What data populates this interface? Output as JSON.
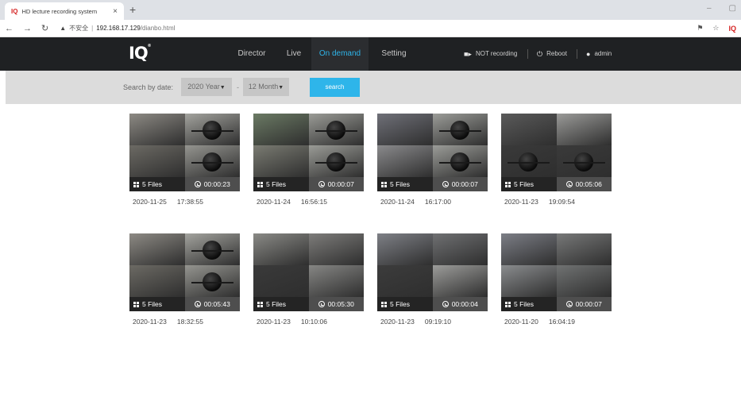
{
  "browser": {
    "tab_title": "HD lecture recording system",
    "tab_favicon": "IQ",
    "tab_close": "×",
    "new_tab": "+",
    "insecure_label": "不安全",
    "url_host": "192.168.17.129",
    "url_path": "/dianbo.html",
    "extension_label": "IQ",
    "win_min": "–",
    "win_max": "▢"
  },
  "nav": {
    "logo": "IQ",
    "logo_mark": "®",
    "items": [
      {
        "label": "Director",
        "active": false
      },
      {
        "label": "Live",
        "active": false
      },
      {
        "label": "On demand",
        "active": true
      },
      {
        "label": "Setting",
        "active": false
      }
    ],
    "recording_status": "NOT recording",
    "reboot_label": "Reboot",
    "user_label": "admin",
    "accent_color": "#2eb3e8"
  },
  "search": {
    "label": "Search by date:",
    "year_value": "2020 Year",
    "month_value": "12 Month",
    "separator": "-",
    "button_label": "search"
  },
  "recordings": [
    {
      "files": "5 Files",
      "duration": "00:00:23",
      "date": "2020-11-25",
      "time": "17:38:55",
      "style": "A"
    },
    {
      "files": "5 Files",
      "duration": "00:00:07",
      "date": "2020-11-24",
      "time": "16:56:15",
      "style": "B"
    },
    {
      "files": "5 Files",
      "duration": "00:00:07",
      "date": "2020-11-24",
      "time": "16:17:00",
      "style": "C"
    },
    {
      "files": "5 Files",
      "duration": "00:05:06",
      "date": "2020-11-23",
      "time": "19:09:54",
      "style": "D"
    },
    {
      "files": "5 Files",
      "duration": "00:05:43",
      "date": "2020-11-23",
      "time": "18:32:55",
      "style": "A"
    },
    {
      "files": "5 Files",
      "duration": "00:05:30",
      "date": "2020-11-23",
      "time": "10:10:06",
      "style": "E"
    },
    {
      "files": "5 Files",
      "duration": "00:00:04",
      "date": "2020-11-23",
      "time": "09:19:10",
      "style": "F"
    },
    {
      "files": "5 Files",
      "duration": "00:00:07",
      "date": "2020-11-20",
      "time": "16:04:19",
      "style": "G"
    }
  ]
}
